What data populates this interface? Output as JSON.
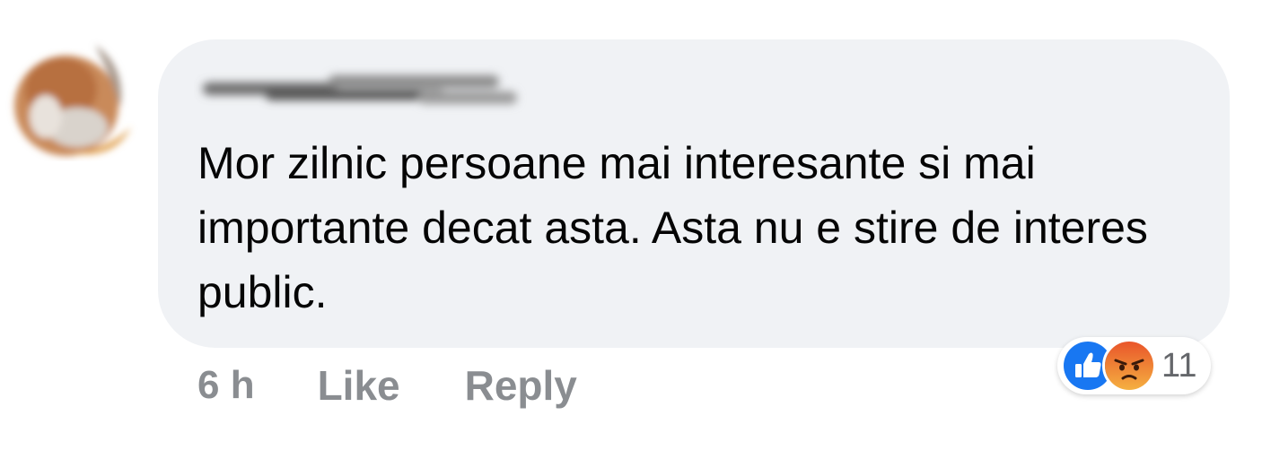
{
  "comment": {
    "text": "Mor zilnic persoane mai interesante si mai importante decat asta. Asta nu e stire de interes public."
  },
  "actions": {
    "time": "6 h",
    "like_label": "Like",
    "reply_label": "Reply"
  },
  "reactions": {
    "icons": [
      "like-icon",
      "angry-icon"
    ],
    "count": "11",
    "like_color": "#1877f2",
    "angry_color": "#f0793a"
  },
  "colors": {
    "bubble": "#f0f2f5",
    "text": "#050505",
    "muted": "#8a8d91"
  }
}
